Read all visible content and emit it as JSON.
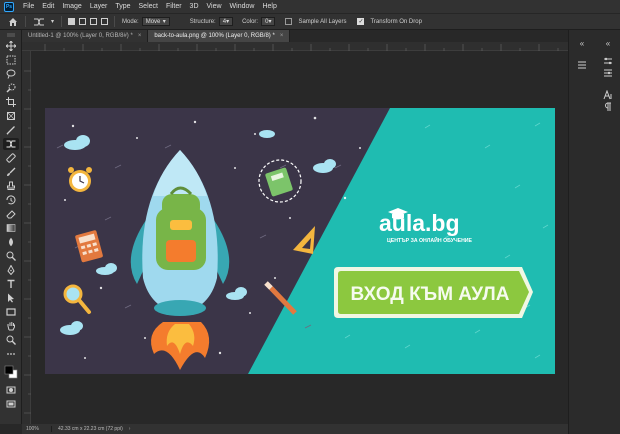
{
  "app": {
    "logo": "Ps"
  },
  "menu": [
    "File",
    "Edit",
    "Image",
    "Layer",
    "Type",
    "Select",
    "Filter",
    "3D",
    "View",
    "Window",
    "Help"
  ],
  "options": {
    "mode_label": "Mode:",
    "mode_value": "Move",
    "structure_label": "Structure:",
    "structure_value": "4",
    "color_label": "Color:",
    "color_value": "0",
    "sample_all_layers": "Sample All Layers",
    "transform_on_drop": "Transform On Drop",
    "transform_on_drop_checked": true,
    "sample_all_layers_checked": false
  },
  "tabs": [
    {
      "label": "Untitled-1 @ 100% (Layer 0, RGB/8#) *",
      "active": false
    },
    {
      "label": "back-to-aula.png @ 100% (Layer 0, RGB/8) *",
      "active": true
    }
  ],
  "tab_close_glyph": "×",
  "status": {
    "zoom": "100%",
    "doc_info": "42.33 cm x 22.23 cm (72 ppi)"
  },
  "artwork": {
    "logo_text": "aula.bg",
    "tagline": "ЦЕНТЪР ЗА ОНЛАЙН ОБУЧЕНИЕ",
    "cta_text": "ВХОД КЪМ АУЛА",
    "colors": {
      "dark_bg": "#3b3548",
      "teal": "#1fbcb1",
      "cta_green": "#8cc83f",
      "cta_border": "#f0f7e4"
    }
  },
  "icons": {
    "tools": [
      "move-icon",
      "marquee-icon",
      "lasso-icon",
      "quick-select-icon",
      "crop-icon",
      "frame-icon",
      "eyedropper-icon",
      "content-aware-move-icon",
      "healing-brush-icon",
      "brush-icon",
      "clone-stamp-icon",
      "history-brush-icon",
      "eraser-icon",
      "gradient-icon",
      "blur-icon",
      "dodge-icon",
      "pen-icon",
      "type-icon",
      "path-select-icon",
      "rectangle-icon",
      "hand-icon",
      "zoom-icon",
      "more-tools-icon",
      "color-swatches-icon",
      "quick-mask-icon",
      "screen-mode-icon"
    ]
  }
}
